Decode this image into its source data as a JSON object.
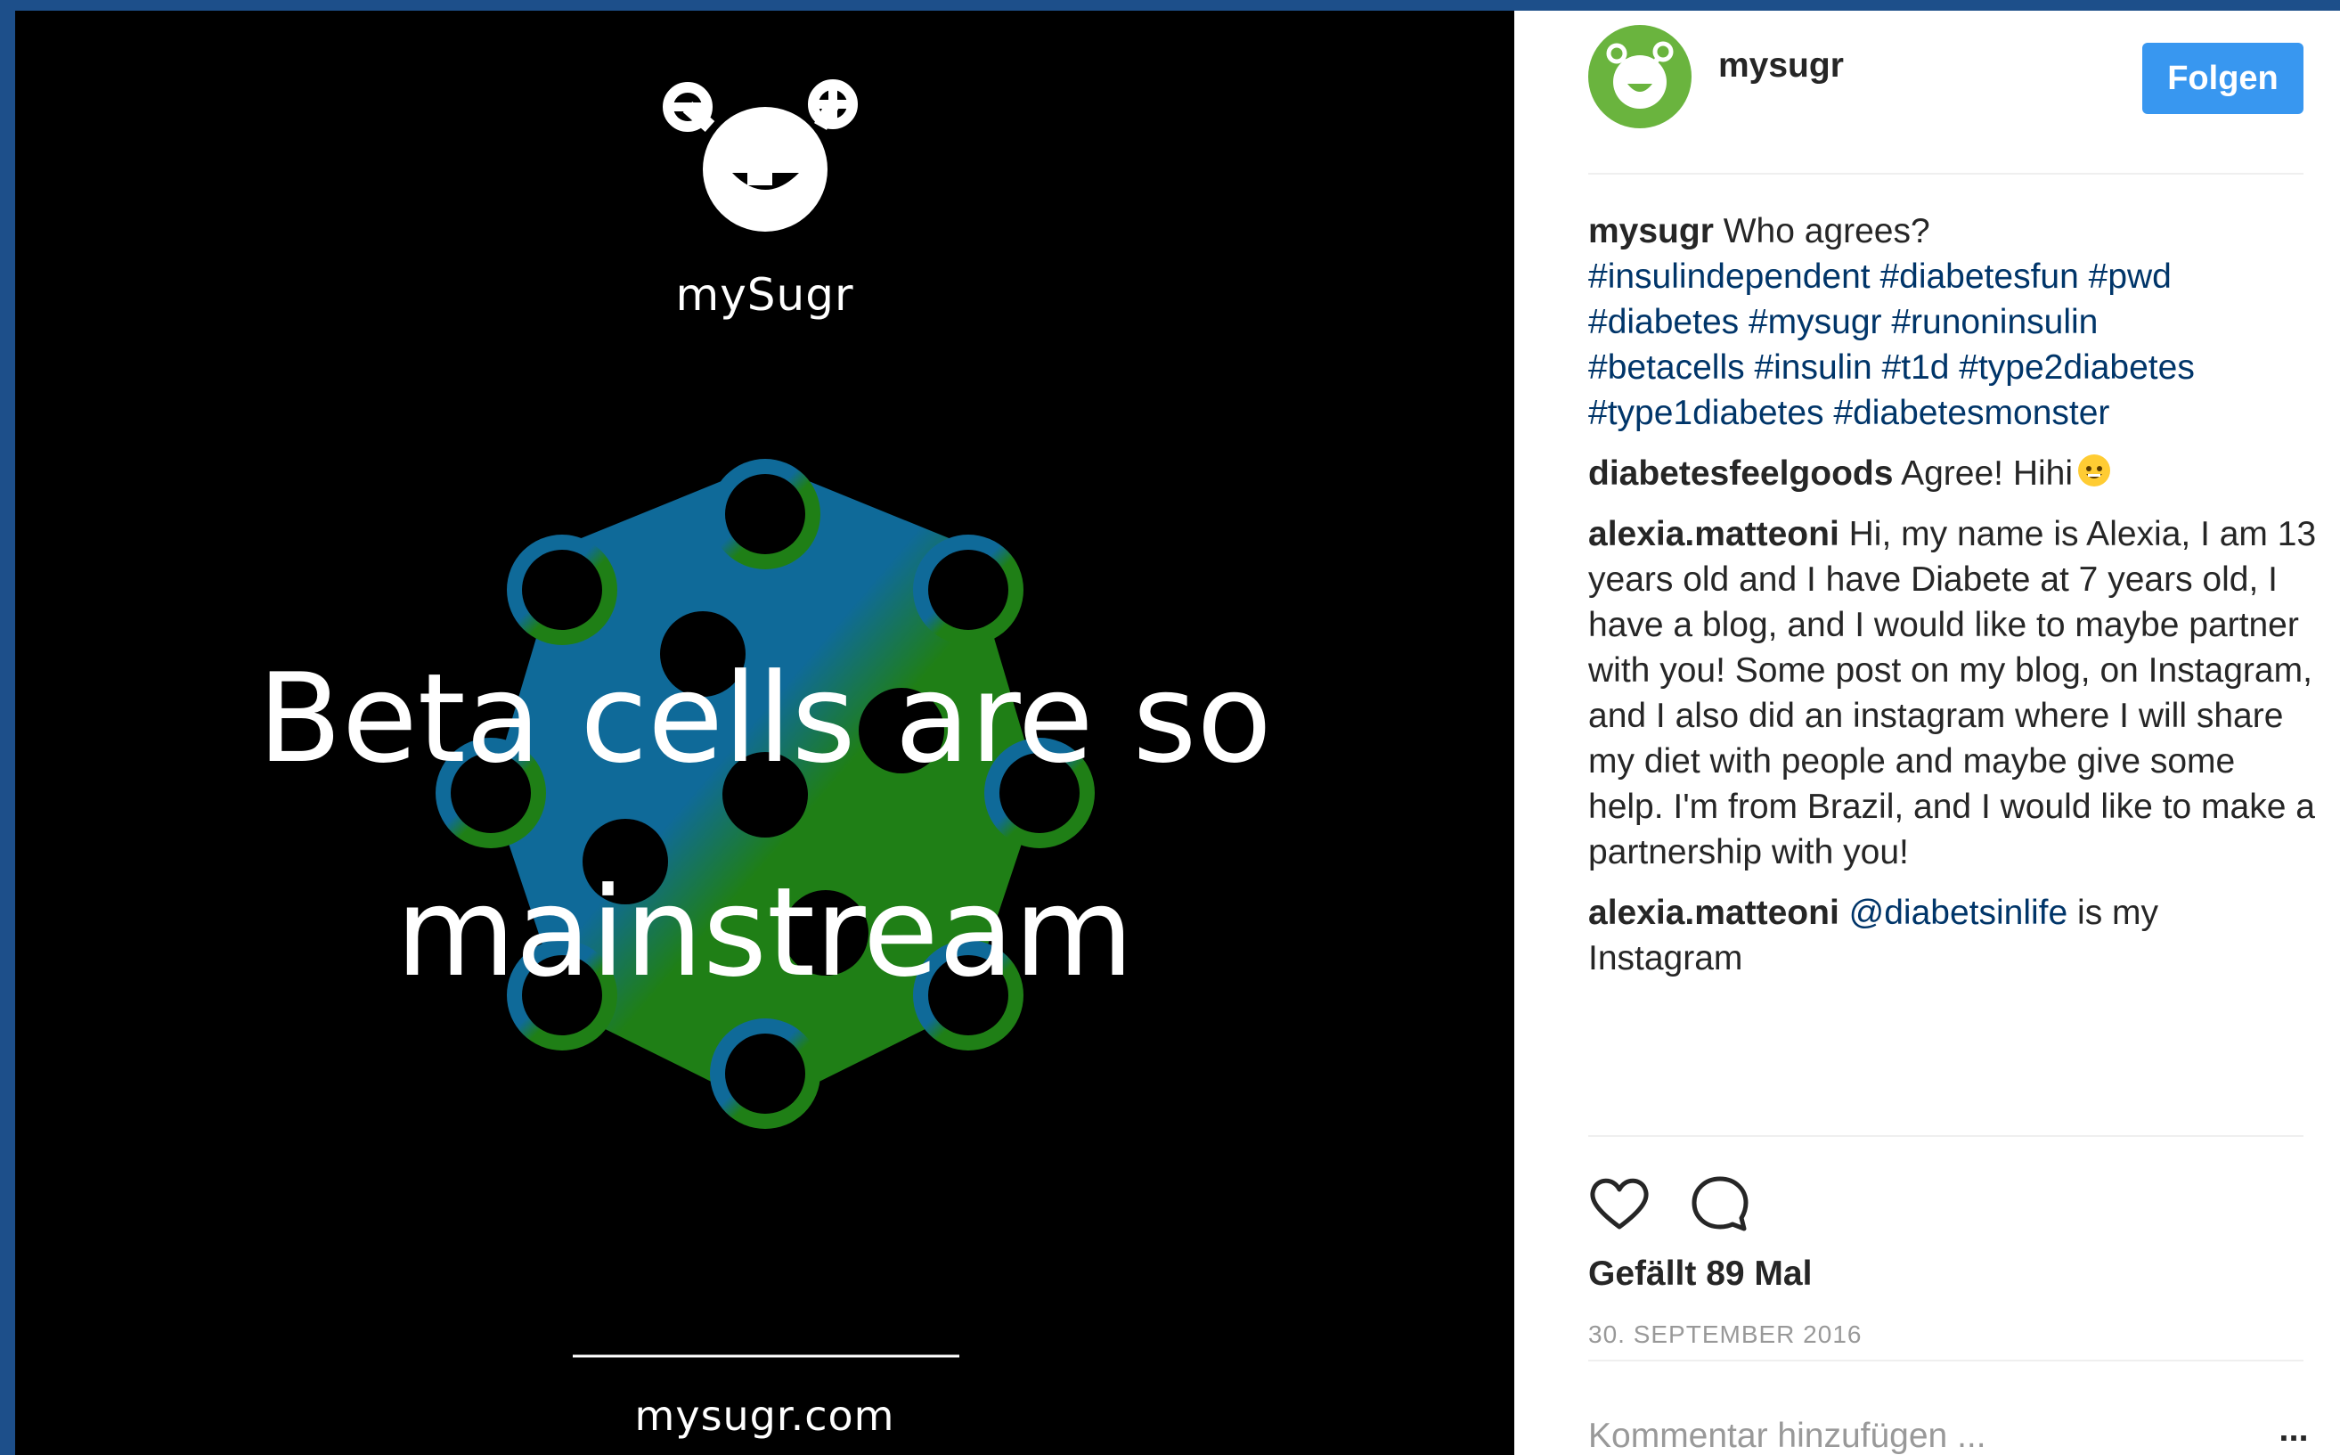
{
  "image": {
    "brand_name": "mySugr",
    "headline_line1": "Beta cells are so",
    "headline_line2": "mainstream",
    "footer_url": "mysugr.com",
    "colors": {
      "blue": "#0f6a99",
      "green": "#1f7f16",
      "background": "#000000"
    }
  },
  "header": {
    "username": "mysugr",
    "follow_label": "Folgen",
    "avatar_color": "#6ab43e"
  },
  "caption": {
    "user": "mysugr",
    "text": " Who agrees?",
    "hashtags_line1": "#insulindependent #diabetesfun #pwd",
    "hashtags_line2": "#diabetes #mysugr #runoninsulin",
    "hashtags_line3": "#betacells #insulin #t1d #type2diabetes",
    "hashtags_line4": "#type1diabetes #diabetesmonster"
  },
  "comments": [
    {
      "user": "diabetesfeelgoods",
      "text": " Agree! Hihi"
    },
    {
      "user": "alexia.matteoni",
      "text": " Hi, my name is Alexia, I am 13 years old and I have Diabete at 7 years old, I have a blog, and I would like to maybe partner with you! Some post on my blog, on Instagram, and I also did an instagram where I will share my diet with people and maybe give some help. I'm from Brazil, and I would like to make a partnership with you!"
    },
    {
      "user": "alexia.matteoni",
      "mention": "@diabetsinlife",
      "text": " is my Instagram"
    }
  ],
  "actions": {
    "like_icon": "heart-icon",
    "comment_icon": "speech-bubble-icon"
  },
  "likes_label": "Gefällt 89 Mal",
  "date_label": "30. SEPTEMBER 2016",
  "comment_input": {
    "placeholder": "Kommentar hinzufügen ..."
  },
  "more_label": "..."
}
